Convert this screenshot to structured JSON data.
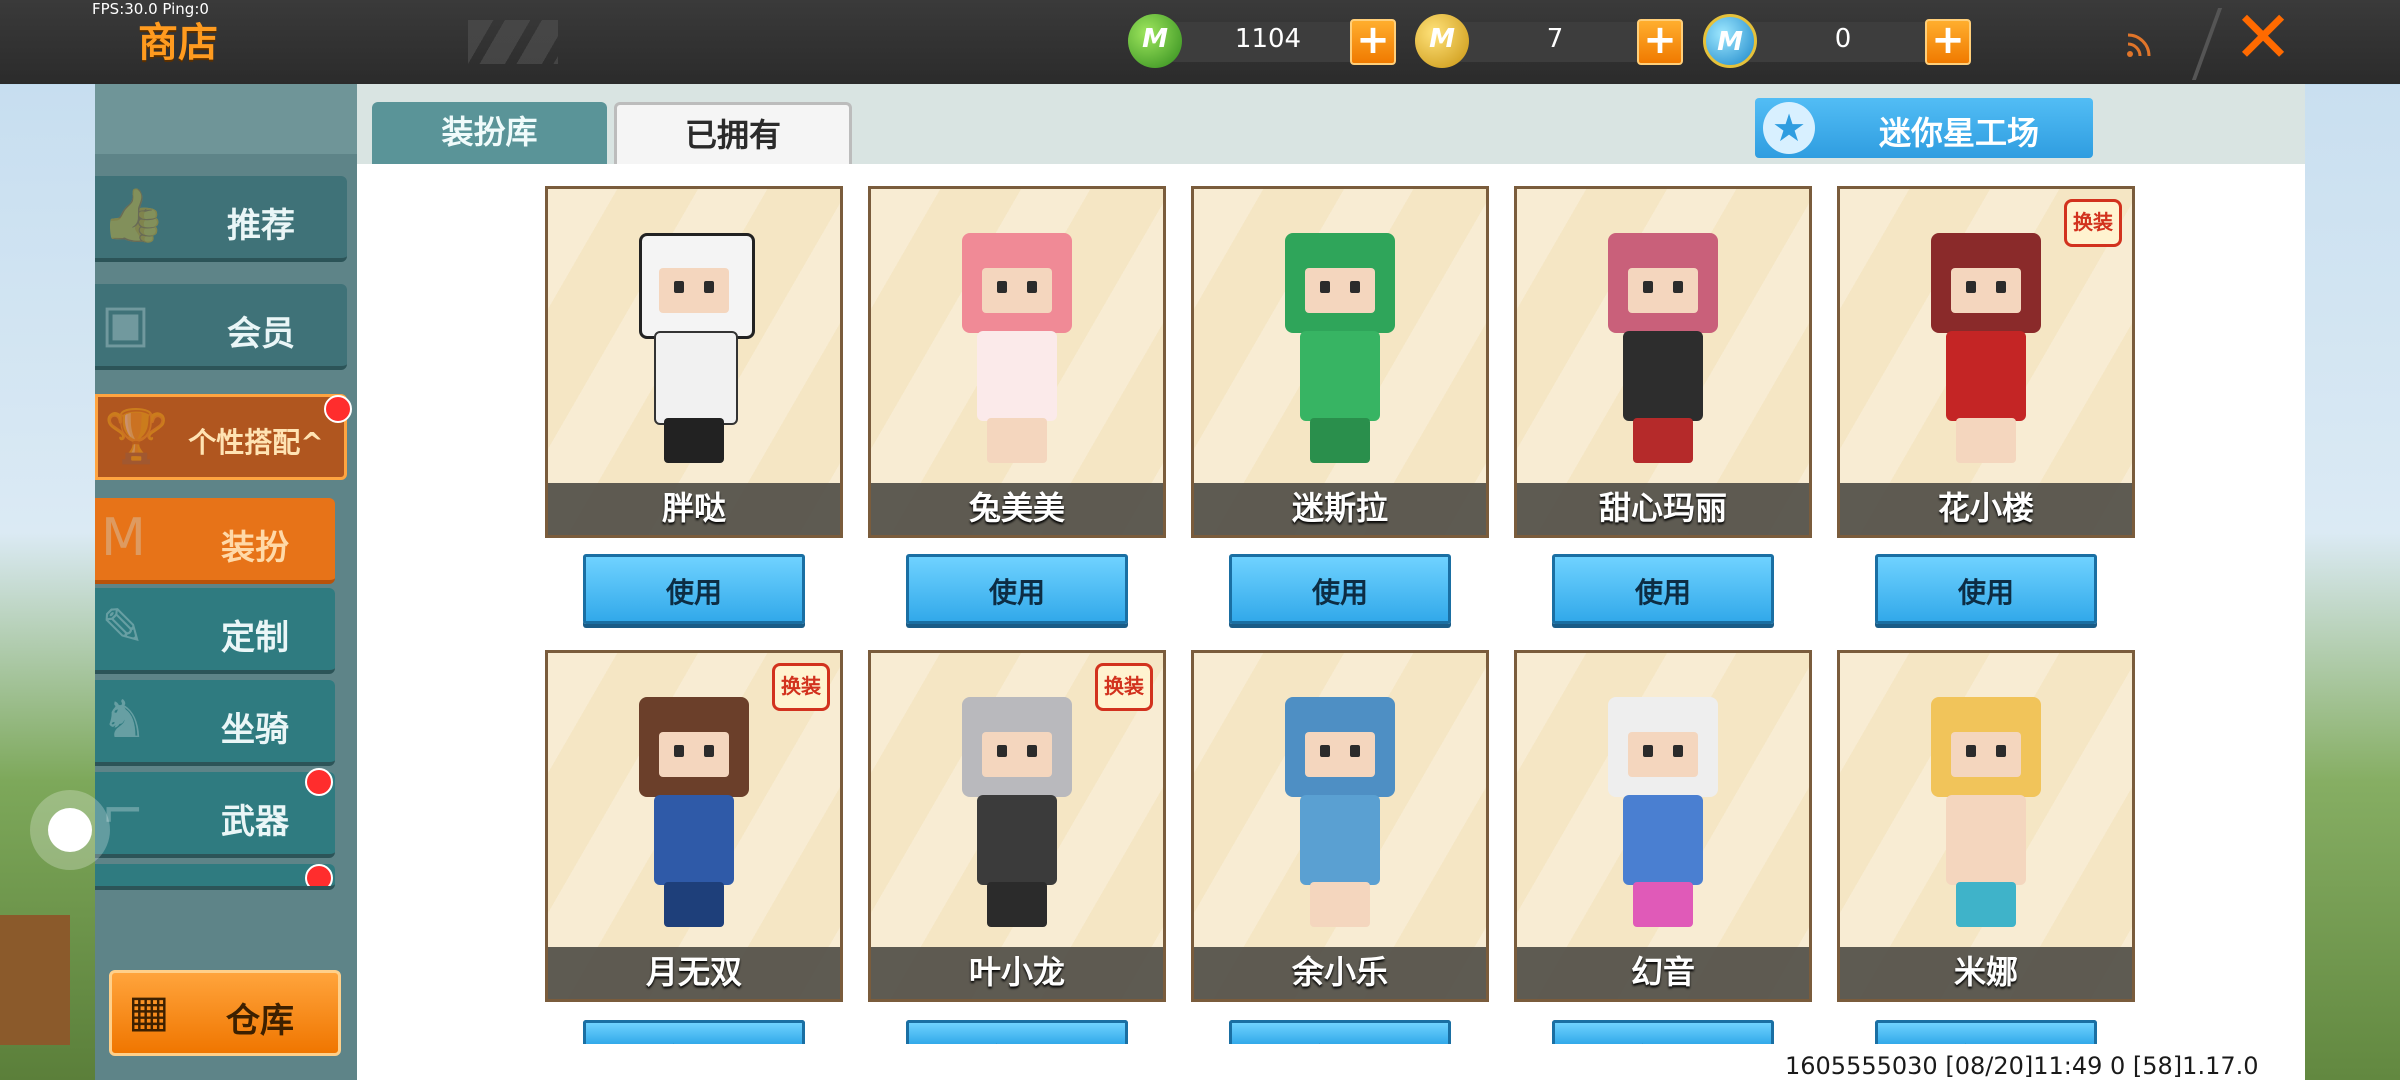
{
  "hud": {
    "fps": "FPS:30.0  Ping:0"
  },
  "header": {
    "title": "商店",
    "currencies": [
      {
        "icon": "green-mini-bean-icon",
        "coin_letter": "M",
        "value": "1104"
      },
      {
        "icon": "gold-mini-coin-icon",
        "coin_letter": "M",
        "value": "7"
      },
      {
        "icon": "blue-mini-point-icon",
        "coin_letter": "M",
        "value": "0"
      }
    ],
    "plus_label": "+",
    "close_label": "✕"
  },
  "sidebar": {
    "items": [
      {
        "label": "推荐",
        "icon": "thumbs-up-icon"
      },
      {
        "label": "会员",
        "icon": "member-icon"
      },
      {
        "label": "个性搭配",
        "icon": "trophy-icon"
      },
      {
        "label": "装扮",
        "icon": "costume-icon"
      },
      {
        "label": "定制",
        "icon": "pencil-icon"
      },
      {
        "label": "坐骑",
        "icon": "mount-icon"
      },
      {
        "label": "武器",
        "icon": "gun-icon"
      }
    ],
    "category_caret": "^",
    "warehouse_label": "仓库"
  },
  "main": {
    "tabs": [
      {
        "label": "装扮库"
      },
      {
        "label": "已拥有"
      }
    ],
    "studio_button": "迷你星工场",
    "use_label": "使用",
    "tag_label": "换装",
    "cards": [
      {
        "name": "胖哒"
      },
      {
        "name": "兔美美"
      },
      {
        "name": "迷斯拉"
      },
      {
        "name": "甜心玛丽"
      },
      {
        "name": "花小楼"
      },
      {
        "name": "月无双"
      },
      {
        "name": "叶小龙"
      },
      {
        "name": "余小乐"
      },
      {
        "name": "幻音"
      },
      {
        "name": "米娜"
      }
    ]
  },
  "footer": {
    "info": "1605555030  [08/20]11:49 0  [58]1.17.0"
  },
  "colors": {
    "accent_orange": "#ff9b1f",
    "sidebar_teal": "#3f7278",
    "active_orange": "#e77318",
    "use_button_blue": "#32a9ea"
  }
}
